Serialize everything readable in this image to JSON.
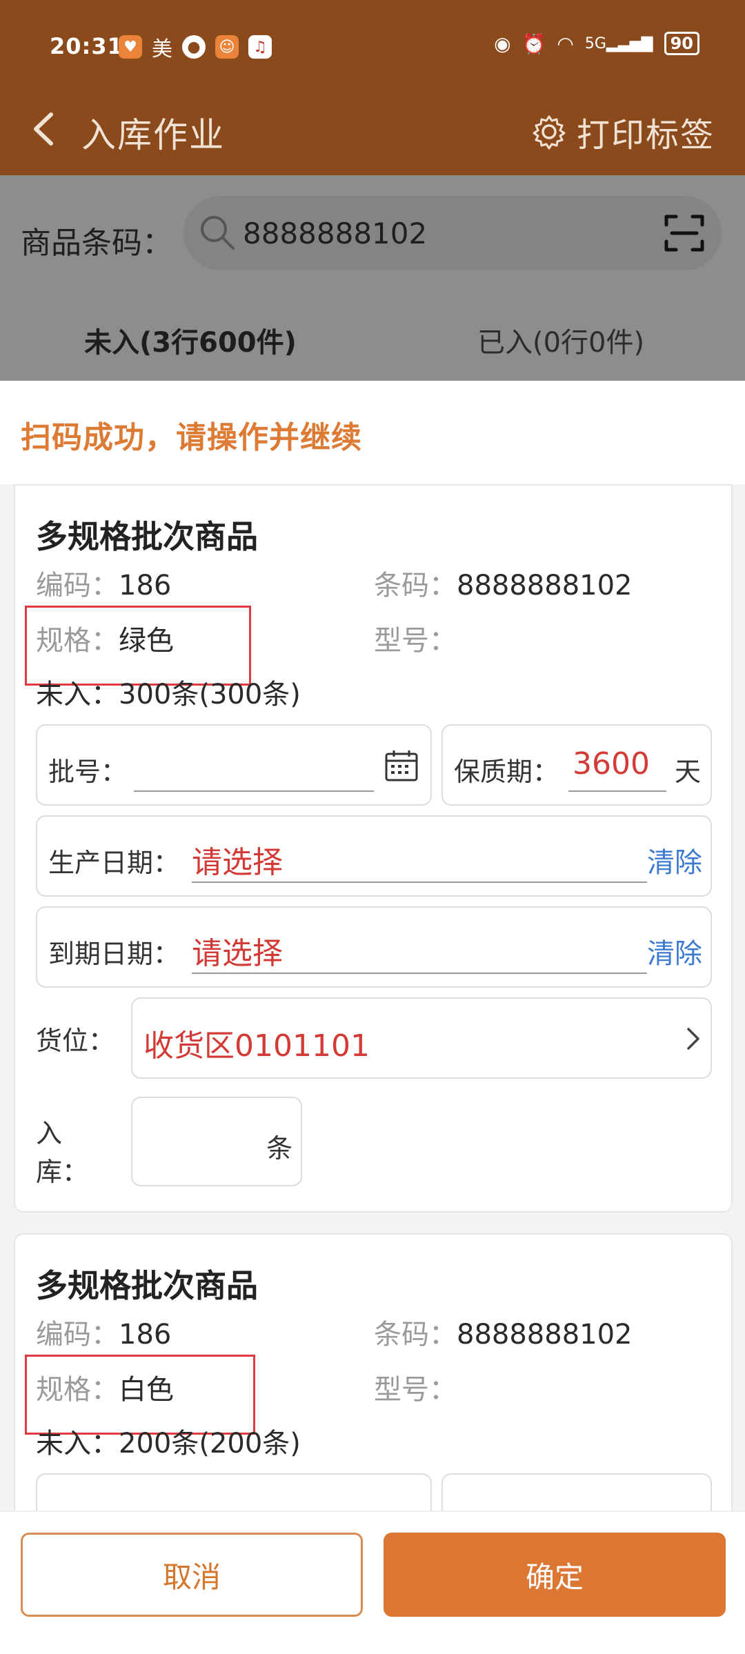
{
  "status_bar": {
    "time": "20:31",
    "app_text": "美",
    "network": "5G",
    "battery": "90"
  },
  "header": {
    "title": "入库作业",
    "print_label": "打印标签"
  },
  "search": {
    "label": "商品条码：",
    "value": "8888888102"
  },
  "tabs": [
    {
      "label": "未入(3行600件)",
      "active": true
    },
    {
      "label": "已入(0行0件)",
      "active": false
    }
  ],
  "sheet": {
    "message": "扫码成功，请操作并继续"
  },
  "cards": [
    {
      "title": "多规格批次商品",
      "code_key": "编码：",
      "code": "186",
      "barcode_key": "条码：",
      "barcode": "8888888102",
      "spec_key": "规格：",
      "spec": "绿色",
      "model_key": "型号：",
      "model": "",
      "pending_key": "未入：",
      "pending": "300条(300条)",
      "batch_label": "批号：",
      "shelf_label": "保质期：",
      "shelf_value": "3600",
      "shelf_unit": "天",
      "prod_label": "生产日期：",
      "prod_value": "请选择",
      "prod_clear": "清除",
      "exp_label": "到期日期：",
      "exp_value": "请选择",
      "exp_clear": "清除",
      "loc_label": "货位：",
      "loc_value": "收货区0101101",
      "in_label_1": "入",
      "in_label_2": "库：",
      "in_unit": "条"
    },
    {
      "title": "多规格批次商品",
      "code_key": "编码：",
      "code": "186",
      "barcode_key": "条码：",
      "barcode": "8888888102",
      "spec_key": "规格：",
      "spec": "白色",
      "model_key": "型号：",
      "model": "",
      "pending_key": "未入：",
      "pending": "200条(200条)"
    }
  ],
  "footer": {
    "cancel": "取消",
    "confirm": "确定"
  },
  "colors": {
    "header_bg": "#8b4a1c",
    "accent_orange": "#dc7633",
    "value_red": "#d33a35",
    "link_blue": "#3d7bd1"
  }
}
